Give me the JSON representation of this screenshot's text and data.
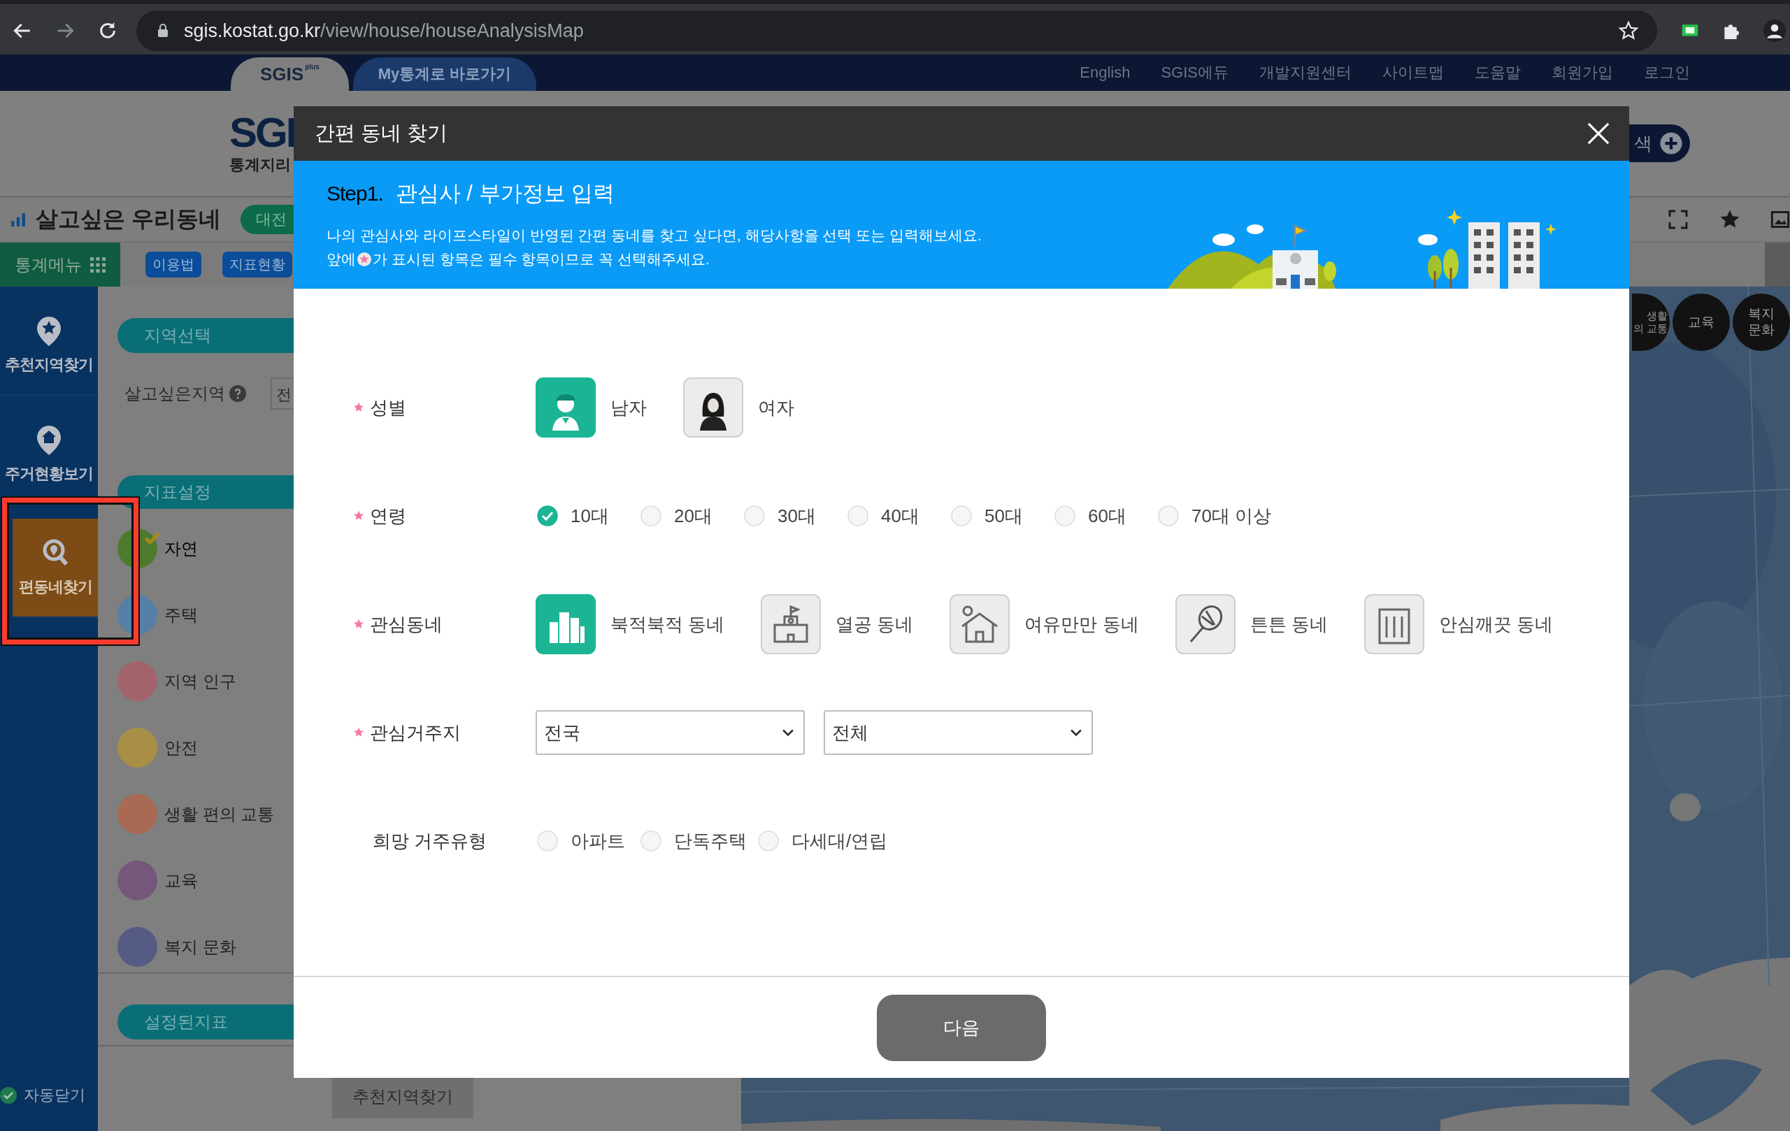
{
  "browser": {
    "url_host": "sgis.kostat.go.kr",
    "url_path": "/view/house/houseAnalysisMap"
  },
  "site_nav": {
    "tabs": [
      {
        "label": "SGIS",
        "sup": "plus",
        "selected": true
      },
      {
        "label": "My통계로 바로가기",
        "selected": false
      }
    ],
    "links": [
      "English",
      "SGIS에듀",
      "개발지원센터",
      "사이트맵",
      "도움말",
      "회원가입",
      "로그인"
    ]
  },
  "page": {
    "logo": "SGI",
    "logo_sub": "통계지리",
    "search_button": "색",
    "title": "살고싶은 우리동네",
    "region_chip": "대전",
    "menu_label": "통계메뉴",
    "menu_buttons": [
      "이용법",
      "지표현황"
    ],
    "side_nav": [
      {
        "label": "추천지역찾기",
        "selected": false
      },
      {
        "label": "주거현황보기",
        "selected": false
      },
      {
        "label": "편동네찾기",
        "selected": true
      }
    ],
    "auto_close": "자동닫기",
    "panel": {
      "region_section": "지역선택",
      "region_label": "살고싶은지역",
      "region_value": "전",
      "indicator_section": "지표설정",
      "indicators": [
        {
          "label": "자연",
          "color": "#4d7a2c",
          "checked": true
        },
        {
          "label": "주택",
          "color": "#557fa6",
          "checked": false
        },
        {
          "label": "지역 인구",
          "color": "#a3636b",
          "checked": false
        },
        {
          "label": "안전",
          "color": "#a88f45",
          "checked": false
        },
        {
          "label": "생활 편의 교통",
          "color": "#a86a52",
          "checked": false
        },
        {
          "label": "교육",
          "color": "#74577a",
          "checked": false
        },
        {
          "label": "복지 문화",
          "color": "#565b83",
          "checked": false
        }
      ],
      "selected_section": "설정된지표",
      "find_button": "추천지역찾기"
    },
    "map_categories": [
      {
        "lines": [
          "생활",
          "의 교통"
        ]
      },
      {
        "lines": [
          "교육"
        ]
      },
      {
        "lines": [
          "복지",
          "문화"
        ]
      }
    ]
  },
  "dialog": {
    "title": "간편 동네 찾기",
    "step": "Step1.",
    "step_title": "관심사 / 부가정보 입력",
    "intro": "나의 관심사와 라이프스타일이 반영된 간편 동네를 찾고 싶다면, 해당사항을 선택 또는 입력해보세요.",
    "notice_before": "앞에",
    "notice_after": "가 표시된 항목은 필수 항목이므로 꼭 선택해주세요.",
    "fields": [
      {
        "kind": "icon_choice",
        "label": "성별",
        "required": true,
        "options": [
          {
            "label": "남자",
            "selected": true
          },
          {
            "label": "여자",
            "selected": false
          }
        ]
      },
      {
        "kind": "radio",
        "label": "연령",
        "required": true,
        "options": [
          {
            "label": "10대",
            "selected": true
          },
          {
            "label": "20대",
            "selected": false
          },
          {
            "label": "30대",
            "selected": false
          },
          {
            "label": "40대",
            "selected": false
          },
          {
            "label": "50대",
            "selected": false
          },
          {
            "label": "60대",
            "selected": false
          },
          {
            "label": "70대 이상",
            "selected": false
          }
        ]
      },
      {
        "kind": "icon_choice",
        "label": "관심동네",
        "required": true,
        "options": [
          {
            "label": "북적북적 동네",
            "selected": true
          },
          {
            "label": "열공 동네",
            "selected": false
          },
          {
            "label": "여유만만 동네",
            "selected": false
          },
          {
            "label": "튼튼 동네",
            "selected": false
          },
          {
            "label": "안심깨끗 동네",
            "selected": false
          }
        ]
      },
      {
        "kind": "select",
        "label": "관심거주지",
        "required": true,
        "selects": [
          "전국",
          "전체"
        ]
      },
      {
        "kind": "radio",
        "label": "희망 거주유형",
        "required": false,
        "options": [
          {
            "label": "아파트",
            "selected": false
          },
          {
            "label": "단독주택",
            "selected": false
          },
          {
            "label": "다세대/연립",
            "selected": false
          }
        ]
      }
    ],
    "next_button": "다음"
  }
}
